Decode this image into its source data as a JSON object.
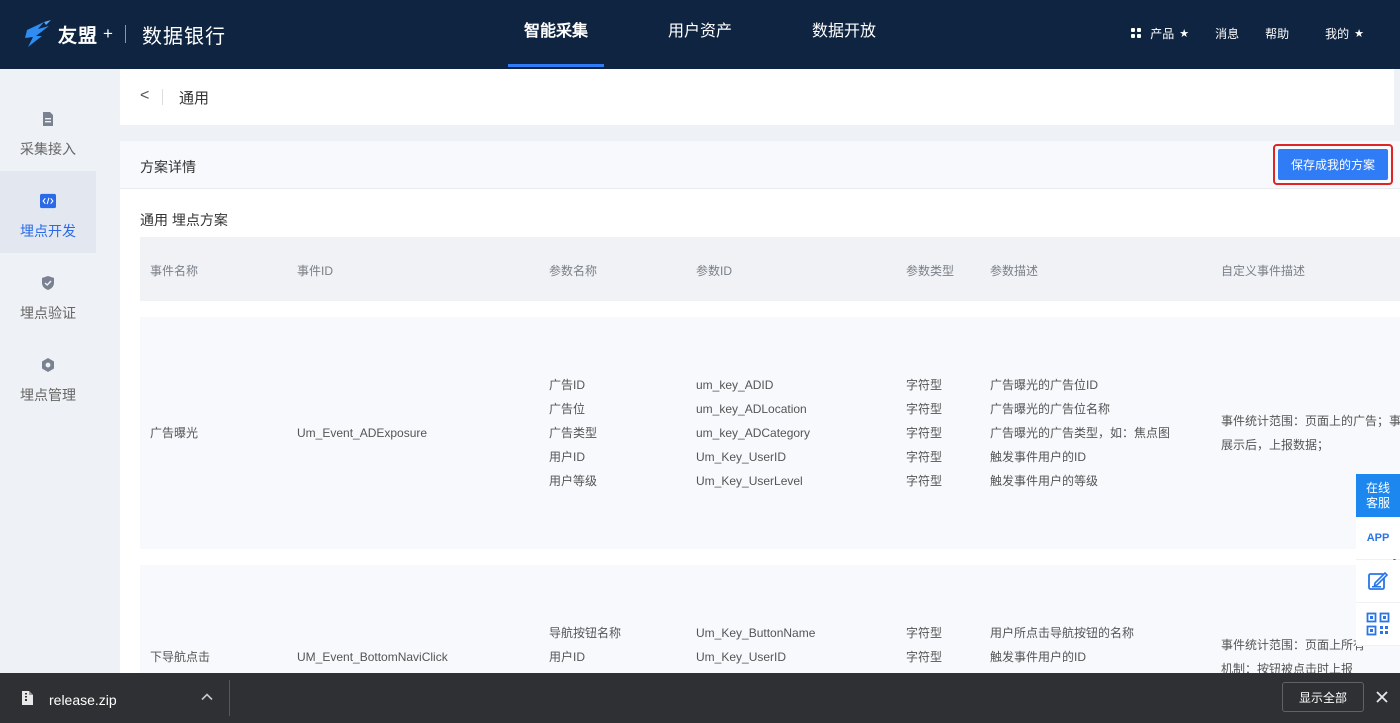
{
  "topbar": {
    "brand": "友盟",
    "brand_plus": "+",
    "product": "数据银行",
    "nav": [
      {
        "label": "智能采集",
        "active": true
      },
      {
        "label": "用户资产",
        "active": false
      },
      {
        "label": "数据开放",
        "active": false
      }
    ],
    "right": {
      "products": "产品",
      "messages": "消息",
      "help": "帮助",
      "mine": "我的",
      "star": "★"
    }
  },
  "sidebar": {
    "items": [
      {
        "label": "采集接入",
        "icon": "document-icon",
        "active": false
      },
      {
        "label": "埋点开发",
        "icon": "code-icon",
        "active": true
      },
      {
        "label": "埋点验证",
        "icon": "shield-check-icon",
        "active": false
      },
      {
        "label": "埋点管理",
        "icon": "hexagon-gear-icon",
        "active": false
      }
    ]
  },
  "header": {
    "back": "<",
    "title": "通用"
  },
  "plan": {
    "title": "方案详情",
    "save_label": "保存成我的方案",
    "scheme_title": "通用 埋点方案",
    "columns": [
      "事件名称",
      "事件ID",
      "参数名称",
      "参数ID",
      "参数类型",
      "参数描述",
      "自定义事件描述"
    ],
    "rows": [
      {
        "event_name": "广告曝光",
        "event_id": "Um_Event_ADExposure",
        "params": [
          {
            "name": "广告ID",
            "id": "um_key_ADID",
            "type": "字符型",
            "desc": "广告曝光的广告位ID"
          },
          {
            "name": "广告位",
            "id": "um_key_ADLocation",
            "type": "字符型",
            "desc": "广告曝光的广告位名称"
          },
          {
            "name": "广告类型",
            "id": "um_key_ADCategory",
            "type": "字符型",
            "desc": "广告曝光的广告类型，如：焦点图"
          },
          {
            "name": "用户ID",
            "id": "Um_Key_UserID",
            "type": "字符型",
            "desc": "触发事件用户的ID"
          },
          {
            "name": "用户等级",
            "id": "Um_Key_UserLevel",
            "type": "字符型",
            "desc": "触发事件用户的等级"
          }
        ],
        "custom_desc": [
          "事件统计范围：页面上的广告；事",
          "展示后，上报数据；"
        ]
      },
      {
        "event_name": "下导航点击",
        "event_id": "UM_Event_BottomNaviClick",
        "params": [
          {
            "name": "导航按钮名称",
            "id": "Um_Key_ButtonName",
            "type": "字符型",
            "desc": "用户所点击导航按钮的名称"
          },
          {
            "name": "用户ID",
            "id": "Um_Key_UserID",
            "type": "字符型",
            "desc": "触发事件用户的ID"
          }
        ],
        "custom_desc": [
          "事件统计范围：页面上所有",
          "机制：按钮被点击时上报"
        ]
      }
    ]
  },
  "float": {
    "chat_line1": "在线",
    "chat_line2": "客服",
    "app": "APP"
  },
  "download": {
    "file": "release.zip",
    "show_all": "显示全部"
  }
}
